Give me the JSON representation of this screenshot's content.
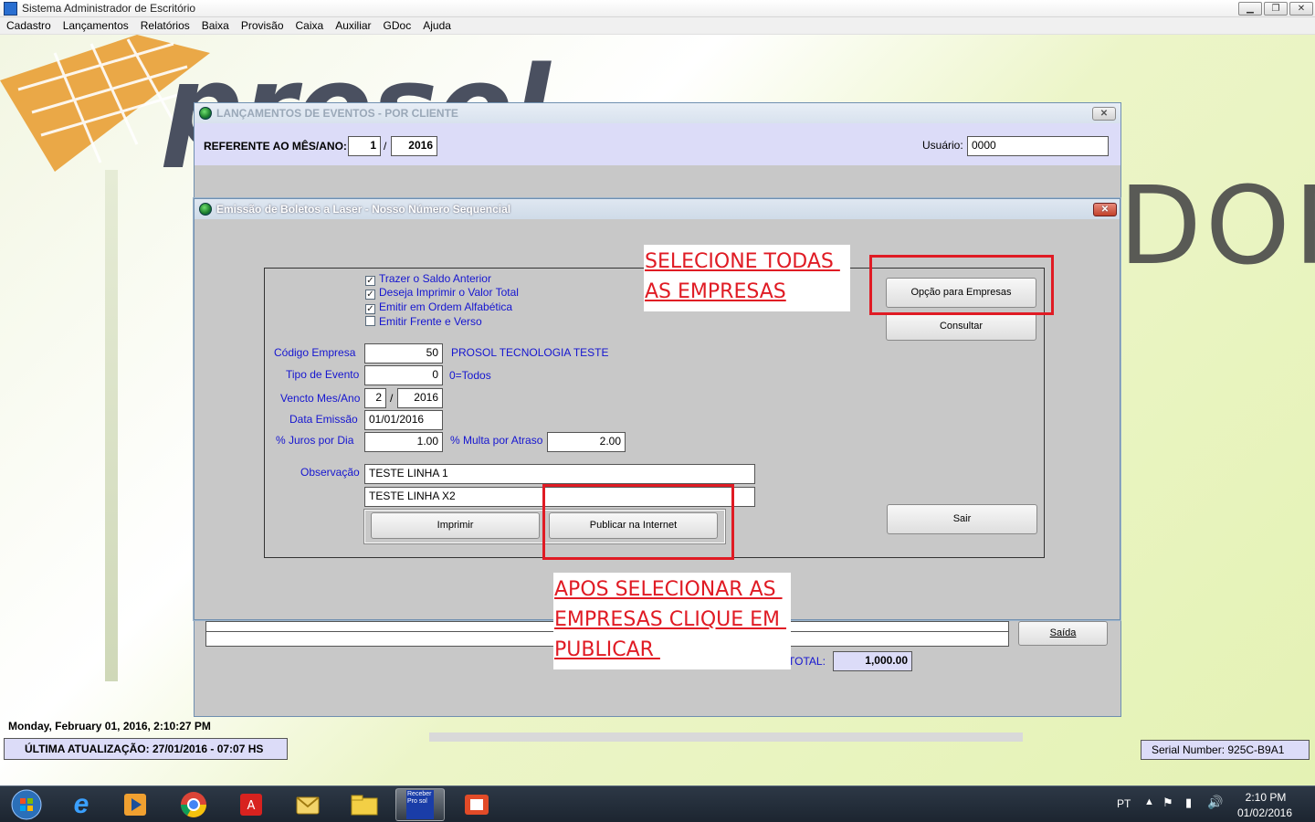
{
  "app": {
    "title": "Sistema Administrador de Escritório"
  },
  "menu": [
    "Cadastro",
    "Lançamentos",
    "Relatórios",
    "Baixa",
    "Provisão",
    "Caixa",
    "Auxiliar",
    "GDoc",
    "Ajuda"
  ],
  "background": {
    "logo_text": "prosol",
    "brand_text": "DOR"
  },
  "events_window": {
    "title": "LANÇAMENTOS DE EVENTOS - POR CLIENTE",
    "referente_label": "REFERENTE AO MÊS/ANO:",
    "mes": "1",
    "ano": "2016",
    "usuario_label": "Usuário:",
    "usuario": "0000",
    "saida_label": "Saída",
    "total_label": "TOTAL:",
    "total_value": "1,000.00"
  },
  "boleto_window": {
    "title": "Emissão de Boletos a Laser - Nosso Número Sequencial",
    "options": [
      {
        "label": "Trazer o Saldo Anterior",
        "checked": true
      },
      {
        "label": "Deseja Imprimir o Valor Total",
        "checked": true
      },
      {
        "label": "Emitir em Ordem Alfabética",
        "checked": true
      },
      {
        "label": "Emitir Frente e Verso",
        "checked": false
      }
    ],
    "codigo_label": "Código Empresa",
    "codigo_value": "50",
    "empresa_nome": "PROSOL TECNOLOGIA TESTE",
    "tipo_label": "Tipo de Evento",
    "tipo_value": "0",
    "tipo_hint": "0=Todos",
    "vencto_label": "Vencto Mes/Ano",
    "vencto_mes": "2",
    "vencto_ano": "2016",
    "data_label": "Data Emissão",
    "data_value": "01/01/2016",
    "juros_label": "% Juros por Dia",
    "juros_value": "1.00",
    "multa_label": "% Multa por Atraso",
    "multa_value": "2.00",
    "obs_label": "Observação",
    "obs_line1": "TESTE LINHA 1",
    "obs_line2": "TESTE LINHA X2",
    "btn_imprimir": "Imprimir",
    "btn_publicar": "Publicar na Internet",
    "btn_opcao": "Opção para Empresas",
    "btn_consultar": "Consultar",
    "btn_sair": "Sair"
  },
  "annotations": {
    "top_line1": "SELECIONE TODAS ",
    "top_line2": "AS EMPRESAS",
    "bottom_line1": "APOS SELECIONAR AS ",
    "bottom_line2": "EMPRESAS CLIQUE EM ",
    "bottom_line3": "PUBLICAR ",
    "highlight_color": "#e01b24"
  },
  "status": {
    "clock": "Monday, February 01, 2016, 2:10:27 PM",
    "update": "ÚLTIMA ATUALIZAÇÃO:  27/01/2016 - 07:07 HS",
    "serial": "Serial Number: 925C-B9A1"
  },
  "taskbar": {
    "apps": [
      "start-orb",
      "internet-explorer",
      "media-player",
      "chrome",
      "acrobat",
      "outlook",
      "explorer-folder",
      "prosol-receber",
      "presentation-app"
    ],
    "active_app_text": "Receber Pro sol",
    "lang": "PT",
    "time": "2:10 PM",
    "date": "01/02/2016"
  }
}
